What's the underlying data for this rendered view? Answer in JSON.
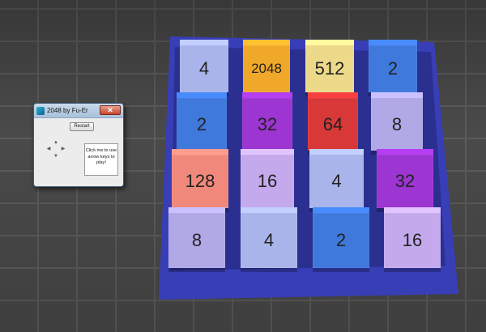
{
  "window": {
    "title": "2048 by Fu-Er",
    "close_glyph": "✕",
    "restart_label": "Restart",
    "hint_text": "Click me to use arrow keys to play!",
    "arrows": {
      "up": "▲",
      "left": "◀",
      "right": "▶",
      "down": "▼"
    }
  },
  "board": {
    "rows": [
      [
        {
          "value": "4",
          "color": "#a9b4ea"
        },
        {
          "value": "2048",
          "color": "#f0a82a"
        },
        {
          "value": "512",
          "color": "#ecd98a"
        },
        {
          "value": "2",
          "color": "#3f79dc"
        }
      ],
      [
        {
          "value": "2",
          "color": "#3f79dc"
        },
        {
          "value": "32",
          "color": "#9d35d2"
        },
        {
          "value": "64",
          "color": "#d83838"
        },
        {
          "value": "8",
          "color": "#b1a8e6"
        }
      ],
      [
        {
          "value": "128",
          "color": "#f0897c"
        },
        {
          "value": "16",
          "color": "#c4aaec"
        },
        {
          "value": "4",
          "color": "#a9b4ea"
        },
        {
          "value": "32",
          "color": "#9d35d2"
        }
      ],
      [
        {
          "value": "8",
          "color": "#b1a8e6"
        },
        {
          "value": "4",
          "color": "#a9b4ea"
        },
        {
          "value": "2",
          "color": "#3f79dc"
        },
        {
          "value": "16",
          "color": "#c4aaec"
        }
      ]
    ]
  }
}
